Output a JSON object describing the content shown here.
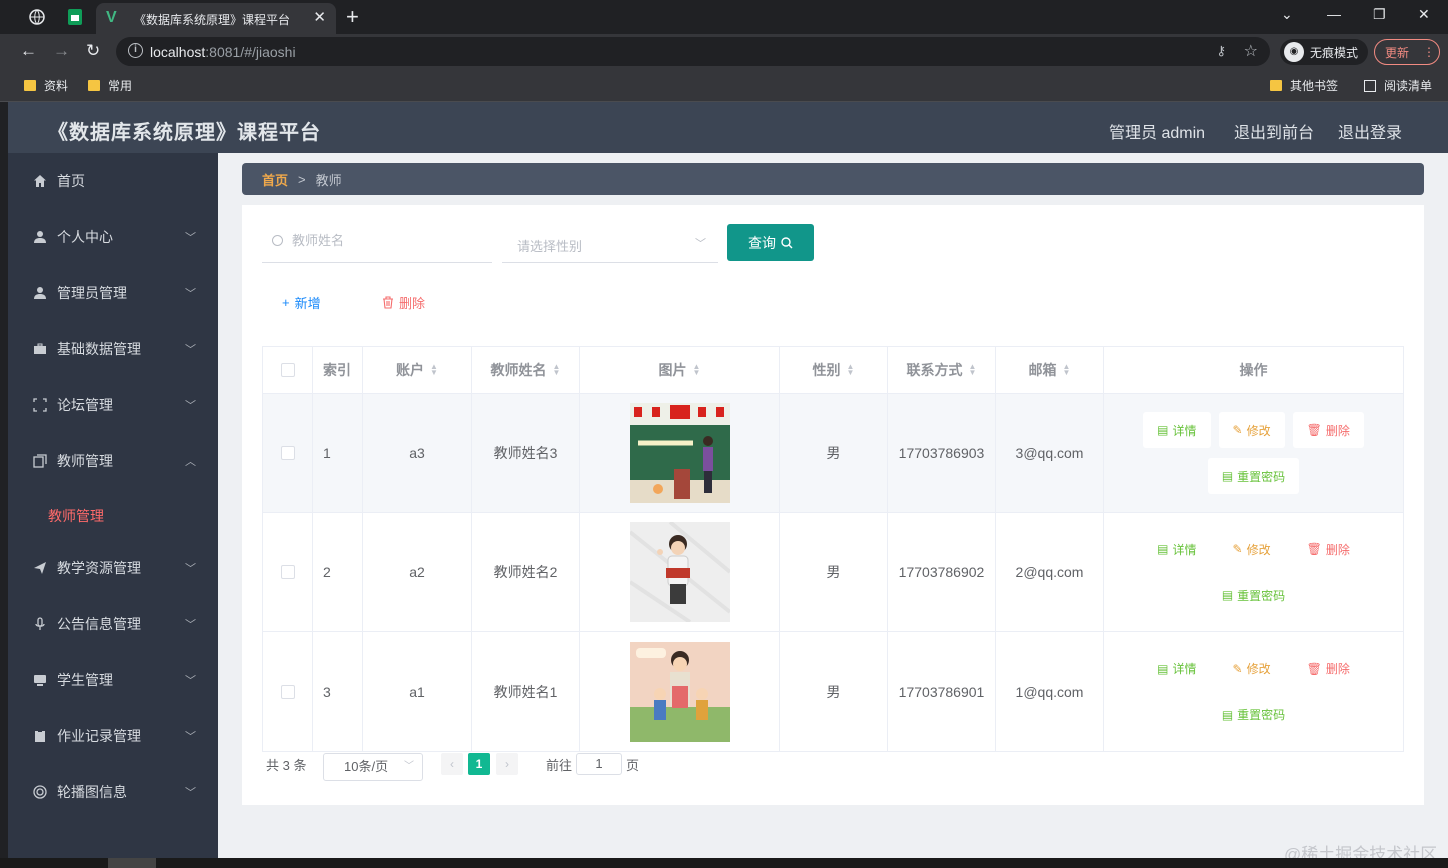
{
  "browser": {
    "tab_title": "《数据库系统原理》课程平台",
    "url_host": "localhost",
    "url_rest": ":8081/#/jiaoshi",
    "incognito_label": "无痕模式",
    "update_label": "更新",
    "bookmarks": [
      "资料",
      "常用"
    ],
    "other_bookmarks": "其他书签",
    "reading_list": "阅读清单"
  },
  "header": {
    "title": "《数据库系统原理》课程平台",
    "user": "管理员 admin",
    "to_front": "退出到前台",
    "logout": "退出登录"
  },
  "sidebar": {
    "items": [
      {
        "label": "首页",
        "icon": "home-icon"
      },
      {
        "label": "个人中心",
        "icon": "user-icon"
      },
      {
        "label": "管理员管理",
        "icon": "admin-icon"
      },
      {
        "label": "基础数据管理",
        "icon": "briefcase-icon"
      },
      {
        "label": "论坛管理",
        "icon": "frame-icon"
      },
      {
        "label": "教师管理",
        "icon": "copy-icon"
      },
      {
        "label": "教学资源管理",
        "icon": "send-icon"
      },
      {
        "label": "公告信息管理",
        "icon": "microphone-icon"
      },
      {
        "label": "学生管理",
        "icon": "monitor-icon"
      },
      {
        "label": "作业记录管理",
        "icon": "clipboard-icon"
      },
      {
        "label": "轮播图信息",
        "icon": "carousel-icon"
      }
    ],
    "sub_active": "教师管理"
  },
  "breadcrumb": {
    "home": "首页",
    "sep": ">",
    "current": "教师"
  },
  "search": {
    "name_placeholder": "教师姓名",
    "gender_placeholder": "请选择性别",
    "query_label": "查询"
  },
  "actions": {
    "add": "新增",
    "delete": "删除"
  },
  "table": {
    "headers": [
      "索引",
      "账户",
      "教师姓名",
      "图片",
      "性别",
      "联系方式",
      "邮箱",
      "操作"
    ],
    "rows": [
      {
        "index": "1",
        "account": "a3",
        "name": "教师姓名3",
        "gender": "男",
        "phone": "17703786903",
        "email": "3@qq.com"
      },
      {
        "index": "2",
        "account": "a2",
        "name": "教师姓名2",
        "gender": "男",
        "phone": "17703786902",
        "email": "2@qq.com"
      },
      {
        "index": "3",
        "account": "a1",
        "name": "教师姓名1",
        "gender": "男",
        "phone": "17703786901",
        "email": "1@qq.com"
      }
    ],
    "op_labels": {
      "detail": "详情",
      "edit": "修改",
      "delete": "删除",
      "reset": "重置密码"
    }
  },
  "pagination": {
    "total": "共 3 条",
    "page_size": "10条/页",
    "current_page": "1",
    "goto_label": "前往",
    "goto_value": "1",
    "page_unit": "页"
  },
  "watermark": "@稀土掘金技术社区",
  "colors": {
    "header_bg": "#3c4554",
    "sidebar_bg": "#2f3644",
    "accent": "#11968a",
    "active_sub": "#ff6a6a"
  }
}
